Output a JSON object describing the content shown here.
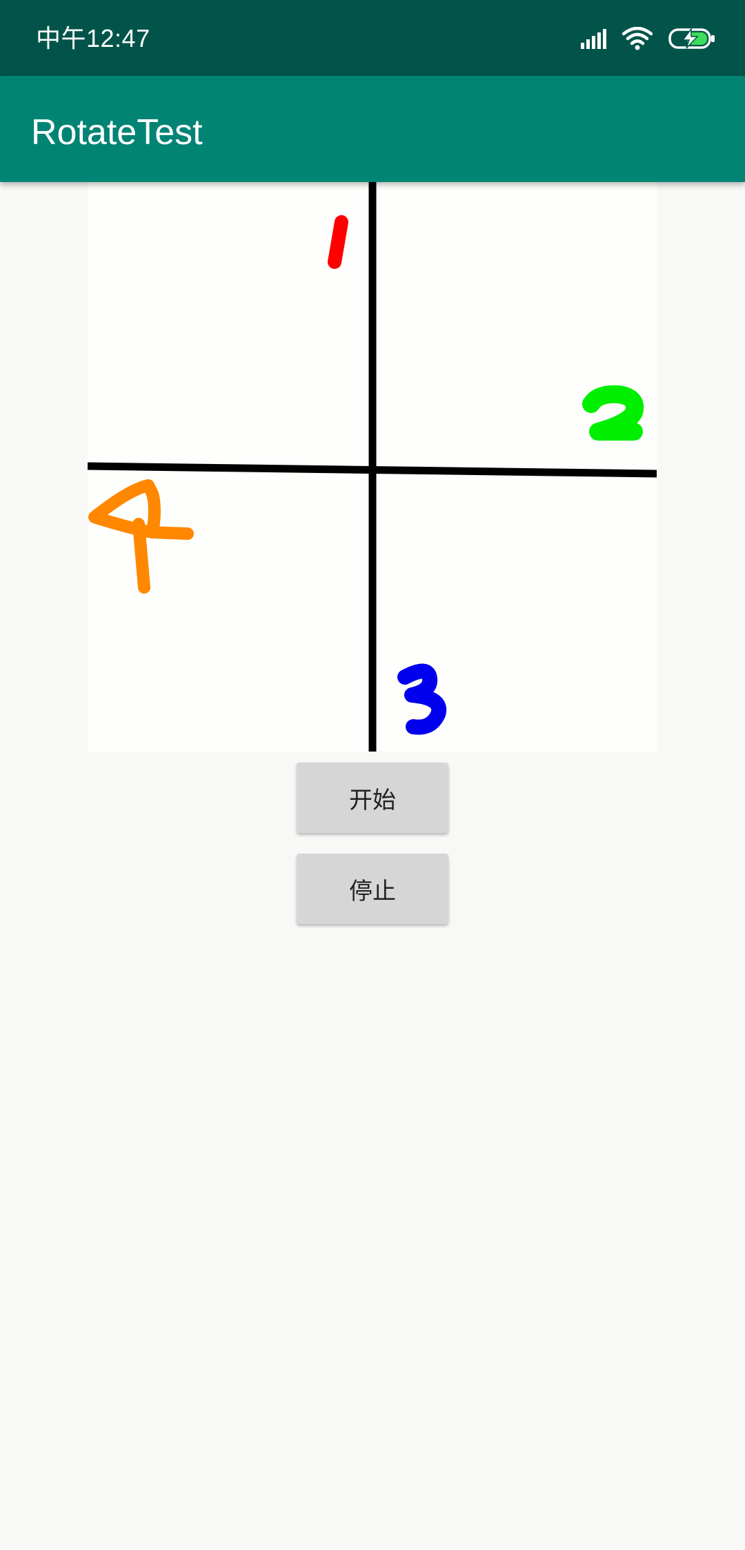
{
  "status_bar": {
    "time": "中午12:47"
  },
  "app_bar": {
    "title": "RotateTest"
  },
  "image": {
    "digits": {
      "top": "1",
      "right": "2",
      "bottom": "3",
      "left": "4"
    },
    "colors": {
      "line": "#000000",
      "digit_1": "#ff0000",
      "digit_2": "#00ee00",
      "digit_3": "#0000ee",
      "digit_4": "#ff8800"
    }
  },
  "buttons": {
    "start_label": "开始",
    "stop_label": "停止"
  },
  "colors": {
    "status_bar": "#02544a",
    "app_bar": "#028474",
    "background": "#f8f8f6",
    "button": "#d6d6d6"
  },
  "icons": [
    "signal-icon",
    "wifi-icon",
    "battery-charging-icon"
  ]
}
